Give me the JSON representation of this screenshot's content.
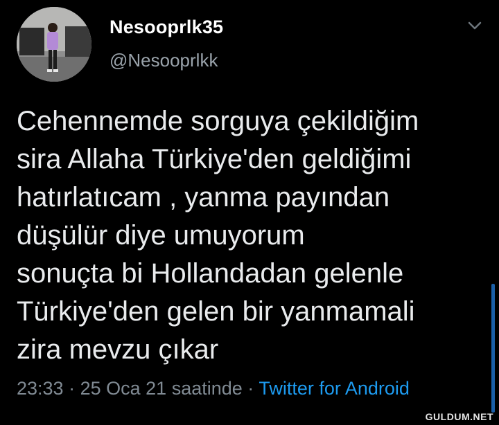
{
  "author": {
    "display_name": "Nesooprlk35",
    "handle": "@Nesooprlkk"
  },
  "icons": {
    "menu": "chevron-down-icon",
    "avatar": "profile-photo"
  },
  "tweet": {
    "lines": [
      "Cehennemde sorguya çekildiğim",
      "sira Allaha Türkiye'den geldiğimi",
      "hatırlatıcam , yanma payından",
      "düşülür diye umuyorum",
      "sonuçta bi Hollandadan gelenle",
      "Türkiye'den gelen bir yanmamali",
      "zira mevzu çıkar"
    ]
  },
  "meta": {
    "time": "23:33",
    "separator": "·",
    "date": "25 Oca 21 saatinde",
    "source": "Twitter for Android"
  },
  "watermark": "GULDUM.NET",
  "colors": {
    "background": "#000000",
    "text": "#e9ebed",
    "muted": "#808a93",
    "link": "#1d9bf0"
  }
}
